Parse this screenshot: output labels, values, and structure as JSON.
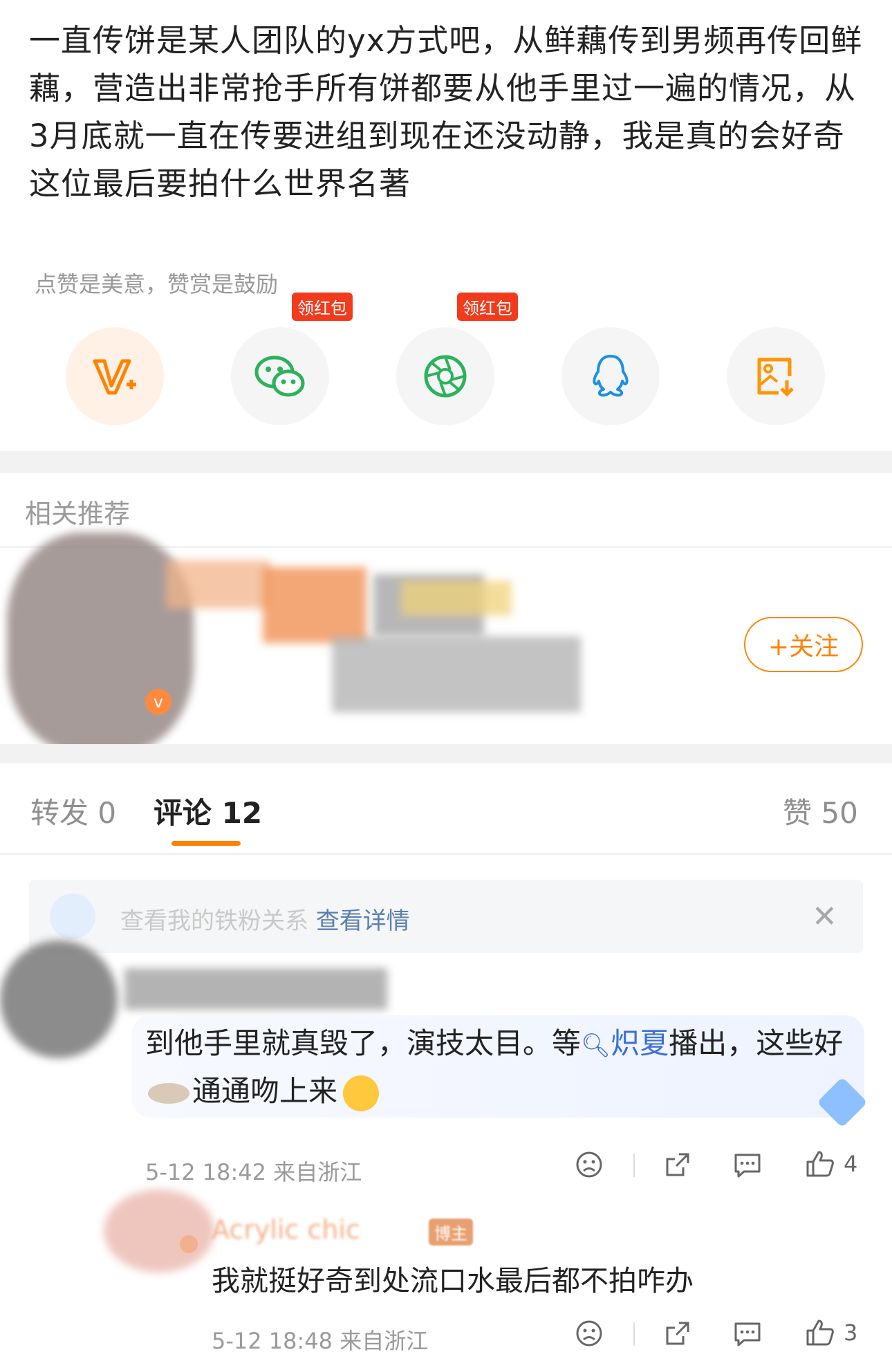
{
  "post": {
    "text": "一直传饼是某人团队的yx方式吧，从鲜藕传到男频再传回鲜藕，营造出非常抢手所有饼都要从他手里过一遍的情况，从3月底就一直在传要进组到现在还没动静，我是真的会好奇这位最后要拍什么世界名著"
  },
  "reward": {
    "hint": "点赞是美意，赞赏是鼓励",
    "badge_label": "领红包",
    "badge_label_2": "领红包"
  },
  "share_icons": [
    "v-plus-reward-icon",
    "wechat-icon",
    "moments-icon",
    "qq-icon",
    "save-image-icon"
  ],
  "related": {
    "title": "相关推荐",
    "follow_label": "+关注"
  },
  "tabs": {
    "repost_label": "转发",
    "repost_count": "0",
    "comment_label": "评论",
    "comment_count": "12",
    "like_label": "赞",
    "like_count": "50"
  },
  "fans_banner": {
    "text": "查看我的铁粉关系",
    "link": "查看详情"
  },
  "comment1": {
    "text_part1": "到他手里就真毁了，演技太目。等",
    "topic": "炽夏",
    "text_part2": "播出，这些好",
    "text_part3": "通通吻上来",
    "meta": "5-12 18:42 来自浙江",
    "like_count": "4"
  },
  "reply1": {
    "username": "Acrylic chic",
    "badge": "博主",
    "text": "我就挺好奇到处流口水最后都不拍咋办",
    "meta": "5-12 18:48 来自浙江",
    "like_count": "3"
  },
  "colors": {
    "accent": "#ff8200",
    "red_badge": "#f23b1c",
    "wechat_green": "#2cb25c",
    "qq_blue": "#1d8fe4",
    "topic_blue": "#3a6fd8"
  }
}
